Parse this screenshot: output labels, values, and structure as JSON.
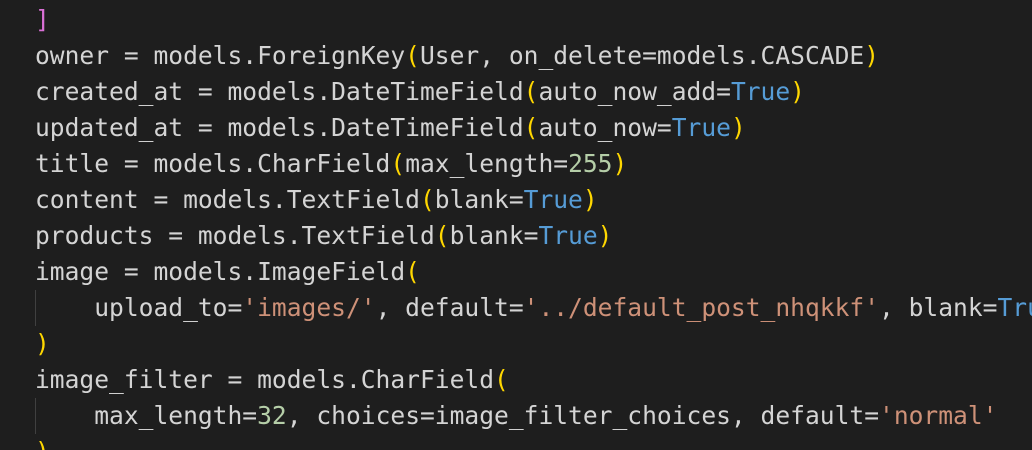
{
  "editor": {
    "lines": [
      [
        {
          "t": "]",
          "c": "b2"
        }
      ],
      [
        {
          "t": "owner = models.ForeignKey",
          "c": "plain"
        },
        {
          "t": "(",
          "c": "b1"
        },
        {
          "t": "User, on_delete=models.CASCADE",
          "c": "plain"
        },
        {
          "t": ")",
          "c": "b1"
        }
      ],
      [
        {
          "t": "created_at = models.DateTimeField",
          "c": "plain"
        },
        {
          "t": "(",
          "c": "b1"
        },
        {
          "t": "auto_now_add=",
          "c": "plain"
        },
        {
          "t": "True",
          "c": "kw"
        },
        {
          "t": ")",
          "c": "b1"
        }
      ],
      [
        {
          "t": "updated_at = models.DateTimeField",
          "c": "plain"
        },
        {
          "t": "(",
          "c": "b1"
        },
        {
          "t": "auto_now=",
          "c": "plain"
        },
        {
          "t": "True",
          "c": "kw"
        },
        {
          "t": ")",
          "c": "b1"
        }
      ],
      [
        {
          "t": "title = models.CharField",
          "c": "plain"
        },
        {
          "t": "(",
          "c": "b1"
        },
        {
          "t": "max_length=",
          "c": "plain"
        },
        {
          "t": "255",
          "c": "num"
        },
        {
          "t": ")",
          "c": "b1"
        }
      ],
      [
        {
          "t": "content = models.TextField",
          "c": "plain"
        },
        {
          "t": "(",
          "c": "b1"
        },
        {
          "t": "blank=",
          "c": "plain"
        },
        {
          "t": "True",
          "c": "kw"
        },
        {
          "t": ")",
          "c": "b1"
        }
      ],
      [
        {
          "t": "products = models.TextField",
          "c": "plain"
        },
        {
          "t": "(",
          "c": "b1"
        },
        {
          "t": "blank=",
          "c": "plain"
        },
        {
          "t": "True",
          "c": "kw"
        },
        {
          "t": ")",
          "c": "b1"
        }
      ],
      [
        {
          "t": "image = models.ImageField",
          "c": "plain"
        },
        {
          "t": "(",
          "c": "b1"
        }
      ],
      [
        {
          "t": "    upload_to=",
          "c": "plain"
        },
        {
          "t": "'images/'",
          "c": "str"
        },
        {
          "t": ", default=",
          "c": "plain"
        },
        {
          "t": "'../default_post_nhqkkf'",
          "c": "str"
        },
        {
          "t": ", blank=",
          "c": "plain"
        },
        {
          "t": "True",
          "c": "kw"
        }
      ],
      [
        {
          "t": ")",
          "c": "b1"
        }
      ],
      [
        {
          "t": "image_filter = models.CharField",
          "c": "plain"
        },
        {
          "t": "(",
          "c": "b1"
        }
      ],
      [
        {
          "t": "    max_length=",
          "c": "plain"
        },
        {
          "t": "32",
          "c": "num"
        },
        {
          "t": ", choices=image_filter_choices, default=",
          "c": "plain"
        },
        {
          "t": "'normal'",
          "c": "str"
        }
      ],
      [
        {
          "t": ")",
          "c": "b1"
        }
      ]
    ]
  },
  "colors": {
    "background": "#1e1e1e",
    "plain": "#d4d4d4",
    "keyword": "#569cd6",
    "number": "#b5cea8",
    "string": "#ce9178",
    "bracket_level1": "#ffd700",
    "bracket_level2": "#da70d6",
    "indent_guide": "#404040"
  }
}
